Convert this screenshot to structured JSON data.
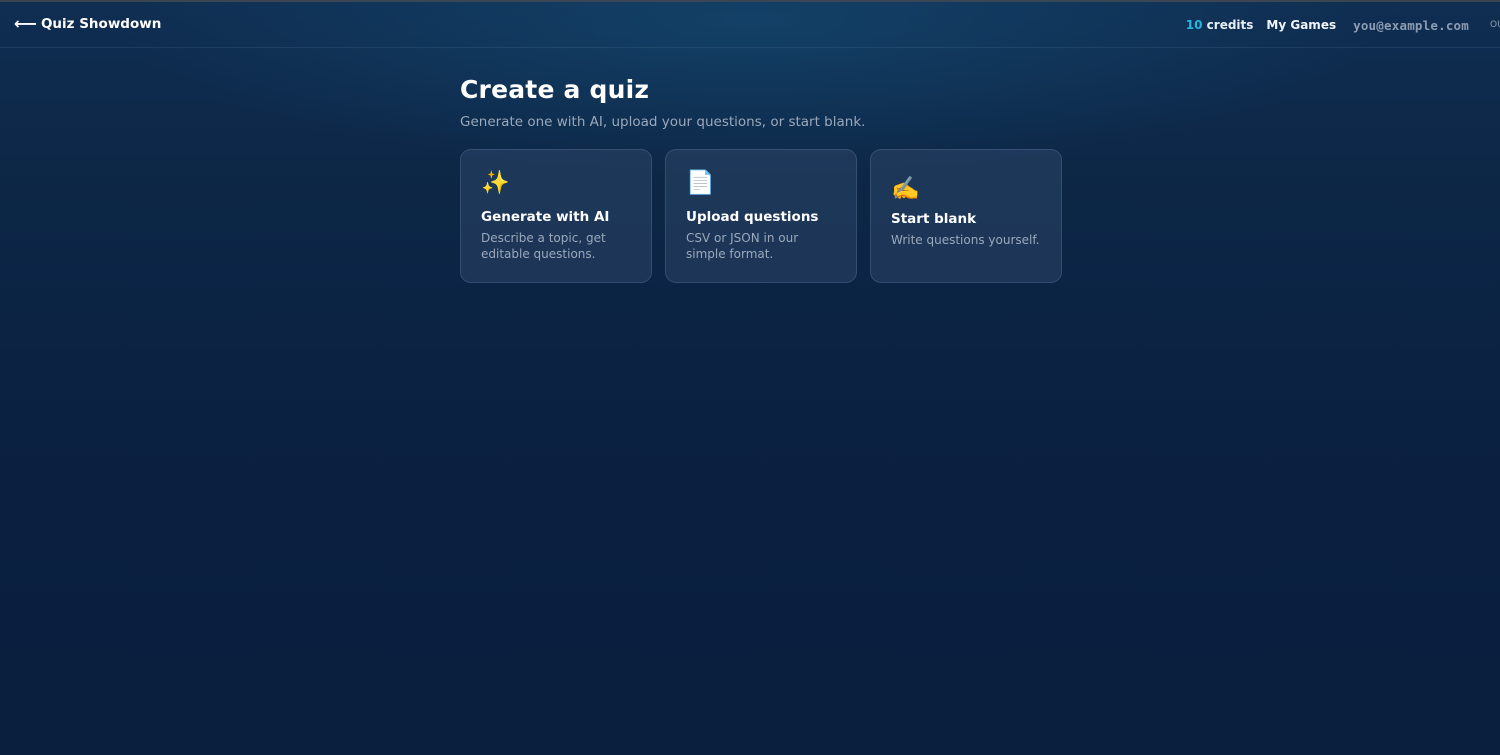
{
  "header": {
    "back_arrow": "⟵",
    "app_title": "Quiz Showdown",
    "credits_count": "10",
    "credits_label": "credits",
    "my_games_label": "My Games",
    "user_email": "you@example.com",
    "cut_off_text": "OU"
  },
  "main": {
    "title": "Create a quiz",
    "subtitle": "Generate one with AI, upload your questions, or start blank.",
    "cards": [
      {
        "icon": "✨",
        "icon_name": "sparkles-icon",
        "title": "Generate with AI",
        "description": "Describe a topic, get editable questions."
      },
      {
        "icon": "📄",
        "icon_name": "document-icon",
        "title": "Upload questions",
        "description": "CSV or JSON in our simple format."
      },
      {
        "icon": "✍️",
        "icon_name": "writing-hand-icon",
        "title": "Start blank",
        "description": "Write questions yourself."
      }
    ]
  },
  "colors": {
    "accent": "#22b8e0",
    "background": "#0b2142",
    "card_background": "#2c4668",
    "muted_text": "#9aa8bb"
  }
}
